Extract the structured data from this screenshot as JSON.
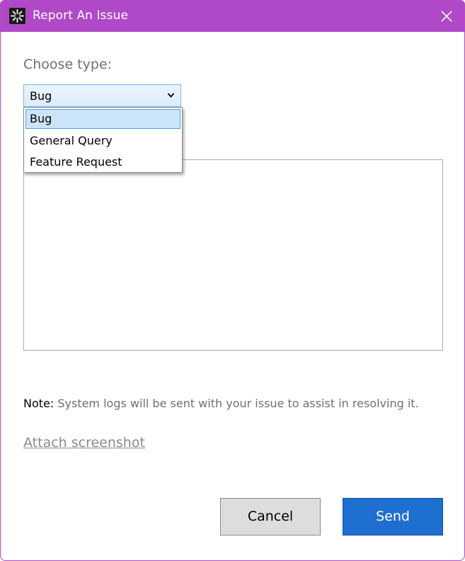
{
  "window": {
    "title": "Report An Issue",
    "accent_color": "#b049c7"
  },
  "form": {
    "choose_type_label": "Choose type:",
    "selected_type": "Bug",
    "type_options": [
      "Bug",
      "General Query",
      "Feature Request"
    ],
    "highlighted_option": "Bug",
    "description_value": "",
    "note_label": "Note:",
    "note_text": " System logs will be sent with your issue to assist in resolving it.",
    "attach_label": "Attach screenshot"
  },
  "actions": {
    "cancel_label": "Cancel",
    "send_label": "Send",
    "send_color": "#1f6fd1"
  },
  "icons": {
    "app": "app-logo-icon",
    "close": "close-icon",
    "dropdown": "chevron-down-icon"
  }
}
